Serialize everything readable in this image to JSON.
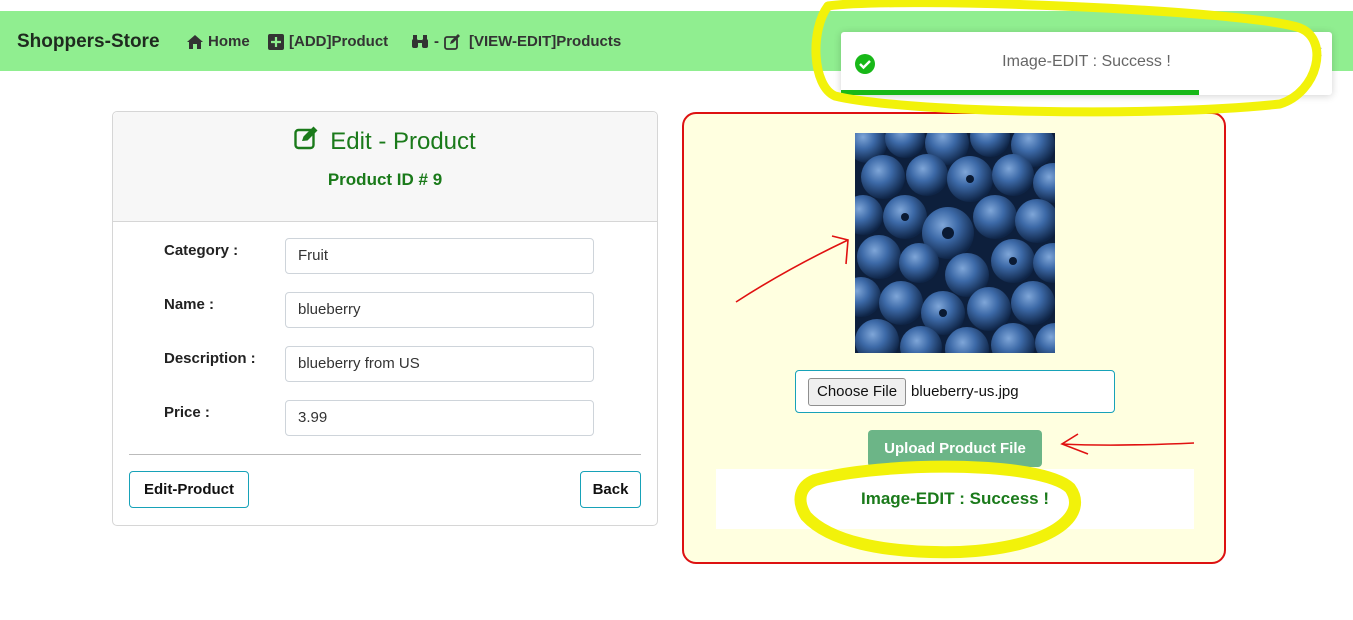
{
  "navbar": {
    "brand": "Shoppers-Store",
    "home_label": "Home",
    "add_label": "[ADD]Product",
    "view_edit_dash": "-",
    "view_edit_label": "[VIEW-EDIT]Products",
    "background_color": "#90ee90"
  },
  "toast": {
    "message": "Image-EDIT : Success !",
    "close_symbol": "×",
    "progress_fraction": 0.73,
    "progress_color": "#18b818"
  },
  "edit_form": {
    "title": "Edit - Product",
    "product_id": "Product ID # 9",
    "fields": [
      {
        "label": "Category :",
        "value": "Fruit"
      },
      {
        "label": "Name :",
        "value": "blueberry"
      },
      {
        "label": "Description :",
        "value": "blueberry from US"
      },
      {
        "label": "Price :",
        "value": "3.99"
      }
    ],
    "edit_button": "Edit-Product",
    "back_button": "Back",
    "accent_color": "#1a7a1a"
  },
  "image_panel": {
    "choose_file_label": "Choose File",
    "file_name": "blueberry-us.jpg",
    "upload_button": "Upload Product File",
    "status_message": "Image-EDIT : Success !",
    "border_color": "#dd1111",
    "background_color": "#ffffe0"
  }
}
